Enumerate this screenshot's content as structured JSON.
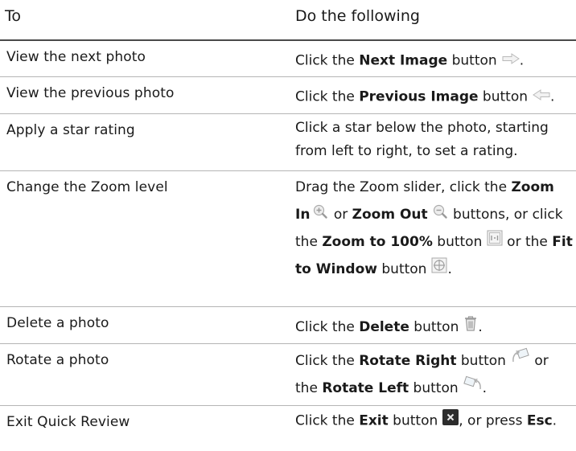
{
  "header": {
    "col1": "To",
    "col2": "Do the following"
  },
  "rows": [
    {
      "to": "View the next photo",
      "do": {
        "t0": "Click the ",
        "b0": "Next Image",
        "t1": " button",
        "t2": "."
      }
    },
    {
      "to": "View the previous photo",
      "do": {
        "t0": "Click the ",
        "b0": "Previous Image",
        "t1": " button",
        "t2": "."
      }
    },
    {
      "to": "Apply a star rating",
      "do": {
        "t0": "Click a star below the photo, starting from left to right, to set a rating."
      }
    },
    {
      "to": "Change the Zoom level",
      "do": {
        "t0": "Drag the Zoom slider, click the ",
        "b0": "Zoom In",
        "t1": " or ",
        "b1": "Zoom Out",
        "t2": " buttons, or click the ",
        "b2": "Zoom to 100%",
        "t3": " button ",
        "t4": " or the ",
        "b3": "Fit to Window",
        "t5": " button",
        "t6": "."
      }
    },
    {
      "to": "Delete a photo",
      "do": {
        "t0": "Click the ",
        "b0": "Delete",
        "t1": " button",
        "t2": "."
      }
    },
    {
      "to": "Rotate a photo",
      "do": {
        "t0": "Click the ",
        "b0": "Rotate Right",
        "t1": " button",
        "t2": " or the ",
        "b1": "Rotate Left",
        "t3": " button",
        "t4": "."
      }
    },
    {
      "to": "Exit Quick Review",
      "do": {
        "t0": "Click the ",
        "b0": "Exit",
        "t1": " button",
        "t2": ", or press ",
        "b1": "Esc",
        "t3": "."
      }
    }
  ],
  "icons": {
    "next": "next-image-icon",
    "previous": "previous-image-icon",
    "zoom_in": "zoom-in-icon",
    "zoom_out": "zoom-out-icon",
    "zoom_100": "zoom-100-icon",
    "fit_window": "fit-to-window-icon",
    "delete": "delete-icon",
    "rotate_right": "rotate-right-icon",
    "rotate_left": "rotate-left-icon",
    "exit": "exit-icon"
  }
}
